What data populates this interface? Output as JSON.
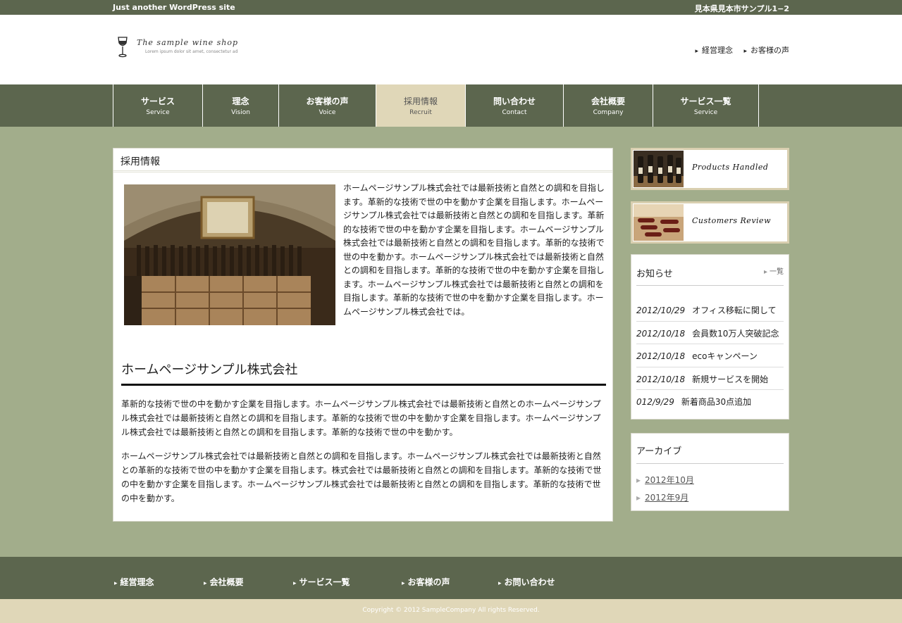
{
  "topbar": {
    "tagline": "Just another WordPress site",
    "address": "見本県見本市サンプル1−2"
  },
  "logo": {
    "name": "The sample wine shop",
    "sub": "Lorem ipsum dolor sit amet, consectetur ad"
  },
  "header_links": [
    "経営理念",
    "お客様の声"
  ],
  "nav": [
    {
      "jp": "サービス",
      "en": "Service"
    },
    {
      "jp": "理念",
      "en": "Vision"
    },
    {
      "jp": "お客様の声",
      "en": "Voice"
    },
    {
      "jp": "採用情報",
      "en": "Recruit",
      "active": true
    },
    {
      "jp": "問い合わせ",
      "en": "Contact"
    },
    {
      "jp": "会社概要",
      "en": "Company"
    },
    {
      "jp": "サービス一覧",
      "en": "Service"
    }
  ],
  "main": {
    "page_title": "採用情報",
    "intro": "ホームページサンプル株式会社では最新技術と自然との調和を目指します。革新的な技術で世の中を動かす企業を目指します。ホームページサンプル株式会社では最新技術と自然との調和を目指します。革新的な技術で世の中を動かす企業を目指します。ホームページサンプル株式会社では最新技術と自然との調和を目指します。革新的な技術で世の中を動かす。ホームページサンプル株式会社では最新技術と自然との調和を目指します。革新的な技術で世の中を動かす企業を目指します。ホームページサンプル株式会社では最新技術と自然との調和を目指します。革新的な技術で世の中を動かす企業を目指します。ホームページサンプル株式会社では。",
    "section_title": "ホームページサンプル株式会社",
    "para1": "革新的な技術で世の中を動かす企業を目指します。ホームページサンプル株式会社では最新技術と自然とのホームページサンプル株式会社では最新技術と自然との調和を目指します。革新的な技術で世の中を動かす企業を目指します。ホームページサンプル株式会社では最新技術と自然との調和を目指します。革新的な技術で世の中を動かす。",
    "para2": "ホームページサンプル株式会社では最新技術と自然との調和を目指します。ホームページサンプル株式会社では最新技術と自然との革新的な技術で世の中を動かす企業を目指します。株式会社では最新技術と自然との調和を目指します。革新的な技術で世の中を動かす企業を目指します。ホームページサンプル株式会社では最新技術と自然との調和を目指します。革新的な技術で世の中を動かす。"
  },
  "banners": [
    "Products Handled",
    "Customers Review"
  ],
  "news": {
    "title": "お知らせ",
    "more": "一覧",
    "items": [
      {
        "date": "2012/10/29",
        "text": "オフィス移転に関して"
      },
      {
        "date": "2012/10/18",
        "text": "会員数10万人突破記念"
      },
      {
        "date": "2012/10/18",
        "text": "ecoキャンペーン"
      },
      {
        "date": "2012/10/18",
        "text": "新規サービスを開始"
      },
      {
        "date": "012/9/29",
        "text": "新着商品30点追加"
      }
    ]
  },
  "archive": {
    "title": "アーカイブ",
    "items": [
      "2012年10月",
      "2012年9月"
    ]
  },
  "footer_links": [
    "経営理念",
    "会社概要",
    "サービス一覧",
    "お客様の声",
    "お問い合わせ"
  ],
  "copyright": "Copyright © 2012 SampleCompany All rights Reserved.",
  "colors": {
    "olive": "#5c664e",
    "sage": "#a2ad8b",
    "beige": "#e0d7b8"
  }
}
